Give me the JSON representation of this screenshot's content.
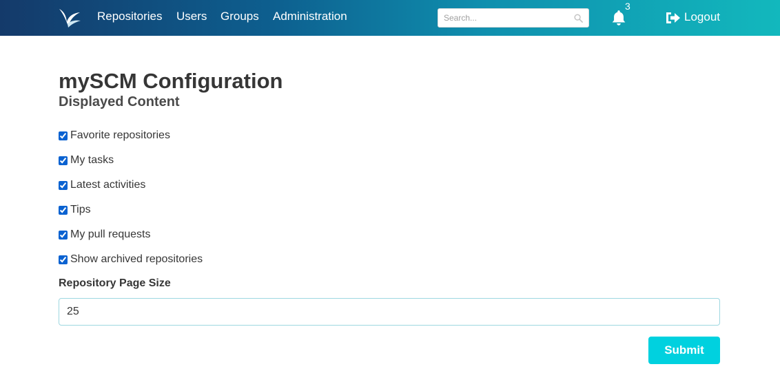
{
  "nav": {
    "logo_icon": "scm-bird-logo",
    "items": [
      {
        "label": "Repositories"
      },
      {
        "label": "Users"
      },
      {
        "label": "Groups"
      },
      {
        "label": "Administration"
      }
    ],
    "search": {
      "placeholder": "Search...",
      "value": "",
      "icon": "search-icon"
    },
    "notifications": {
      "icon": "bell-icon",
      "count": "3"
    },
    "logout": {
      "icon": "sign-out-icon",
      "label": "Logout"
    }
  },
  "main": {
    "title": "mySCM Configuration",
    "subtitle": "Displayed Content",
    "checkboxes": [
      {
        "label": "Favorite repositories",
        "checked": true
      },
      {
        "label": "My tasks",
        "checked": true
      },
      {
        "label": "Latest activities",
        "checked": true
      },
      {
        "label": "Tips",
        "checked": true
      },
      {
        "label": "My pull requests",
        "checked": true
      },
      {
        "label": "Show archived repositories",
        "checked": true
      }
    ],
    "page_size": {
      "label": "Repository Page Size",
      "value": "25"
    },
    "submit_label": "Submit"
  },
  "colors": {
    "nav_gradient_start": "#143a6a",
    "nav_gradient_end": "#12b8bd",
    "submit": "#00d1df",
    "checkbox_accent": "#0a62d1"
  }
}
